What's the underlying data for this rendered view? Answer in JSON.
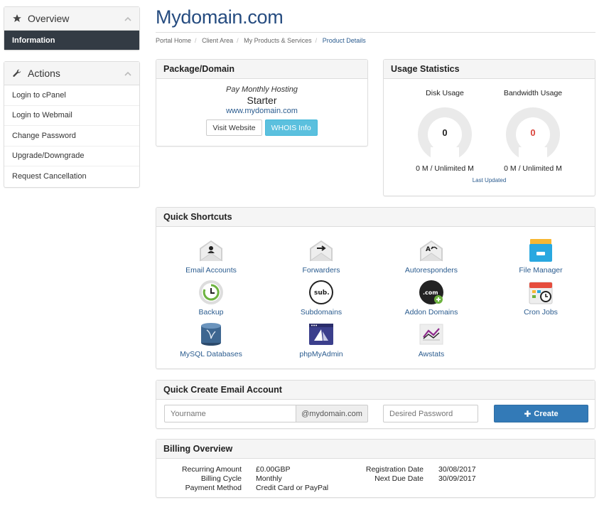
{
  "sidebar": {
    "overview": {
      "title": "Overview",
      "items": [
        {
          "label": "Information"
        }
      ]
    },
    "actions": {
      "title": "Actions",
      "items": [
        {
          "label": "Login to cPanel"
        },
        {
          "label": "Login to Webmail"
        },
        {
          "label": "Change Password"
        },
        {
          "label": "Upgrade/Downgrade"
        },
        {
          "label": "Request Cancellation"
        }
      ]
    }
  },
  "page": {
    "title": "Mydomain.com"
  },
  "breadcrumb": [
    "Portal Home",
    "Client Area",
    "My Products & Services",
    "Product Details"
  ],
  "package": {
    "heading": "Package/Domain",
    "type": "Pay Monthly Hosting",
    "name": "Starter",
    "domain": "www.mydomain.com",
    "visit_label": "Visit Website",
    "whois_label": "WHOIS Info"
  },
  "usage": {
    "heading": "Usage Statistics",
    "disk": {
      "label": "Disk Usage",
      "value": "0",
      "detail": "0 M / Unlimited M"
    },
    "bandwidth": {
      "label": "Bandwidth Usage",
      "value": "0",
      "detail": "0 M / Unlimited M"
    },
    "last_updated": "Last Updated"
  },
  "shortcuts": {
    "heading": "Quick Shortcuts",
    "items": [
      {
        "label": "Email Accounts",
        "icon": "email-accounts-icon"
      },
      {
        "label": "Forwarders",
        "icon": "forwarders-icon"
      },
      {
        "label": "Autoresponders",
        "icon": "autoresponders-icon"
      },
      {
        "label": "File Manager",
        "icon": "file-manager-icon"
      },
      {
        "label": "Backup",
        "icon": "backup-icon"
      },
      {
        "label": "Subdomains",
        "icon": "subdomains-icon"
      },
      {
        "label": "Addon Domains",
        "icon": "addon-domains-icon"
      },
      {
        "label": "Cron Jobs",
        "icon": "cron-jobs-icon"
      },
      {
        "label": "MySQL Databases",
        "icon": "mysql-databases-icon"
      },
      {
        "label": "phpMyAdmin",
        "icon": "phpmyadmin-icon"
      },
      {
        "label": "Awstats",
        "icon": "awstats-icon"
      }
    ]
  },
  "quick_create": {
    "heading": "Quick Create Email Account",
    "username_placeholder": "Yourname",
    "domain_suffix": "@mydomain.com",
    "password_placeholder": "Desired Password",
    "create_label": "Create"
  },
  "billing": {
    "heading": "Billing Overview",
    "left": [
      {
        "label": "Recurring Amount",
        "value": "£0.00GBP"
      },
      {
        "label": "Billing Cycle",
        "value": "Monthly"
      },
      {
        "label": "Payment Method",
        "value": "Credit Card or PayPal"
      }
    ],
    "right": [
      {
        "label": "Registration Date",
        "value": "30/08/2017"
      },
      {
        "label": "Next Due Date",
        "value": "30/09/2017"
      }
    ]
  },
  "colors": {
    "title": "#264c80",
    "link": "#2b5c8f",
    "active_nav": "#333b44",
    "info_button": "#5bc0de",
    "primary_button": "#337ab7",
    "gauge_alert": "#d9443b"
  }
}
